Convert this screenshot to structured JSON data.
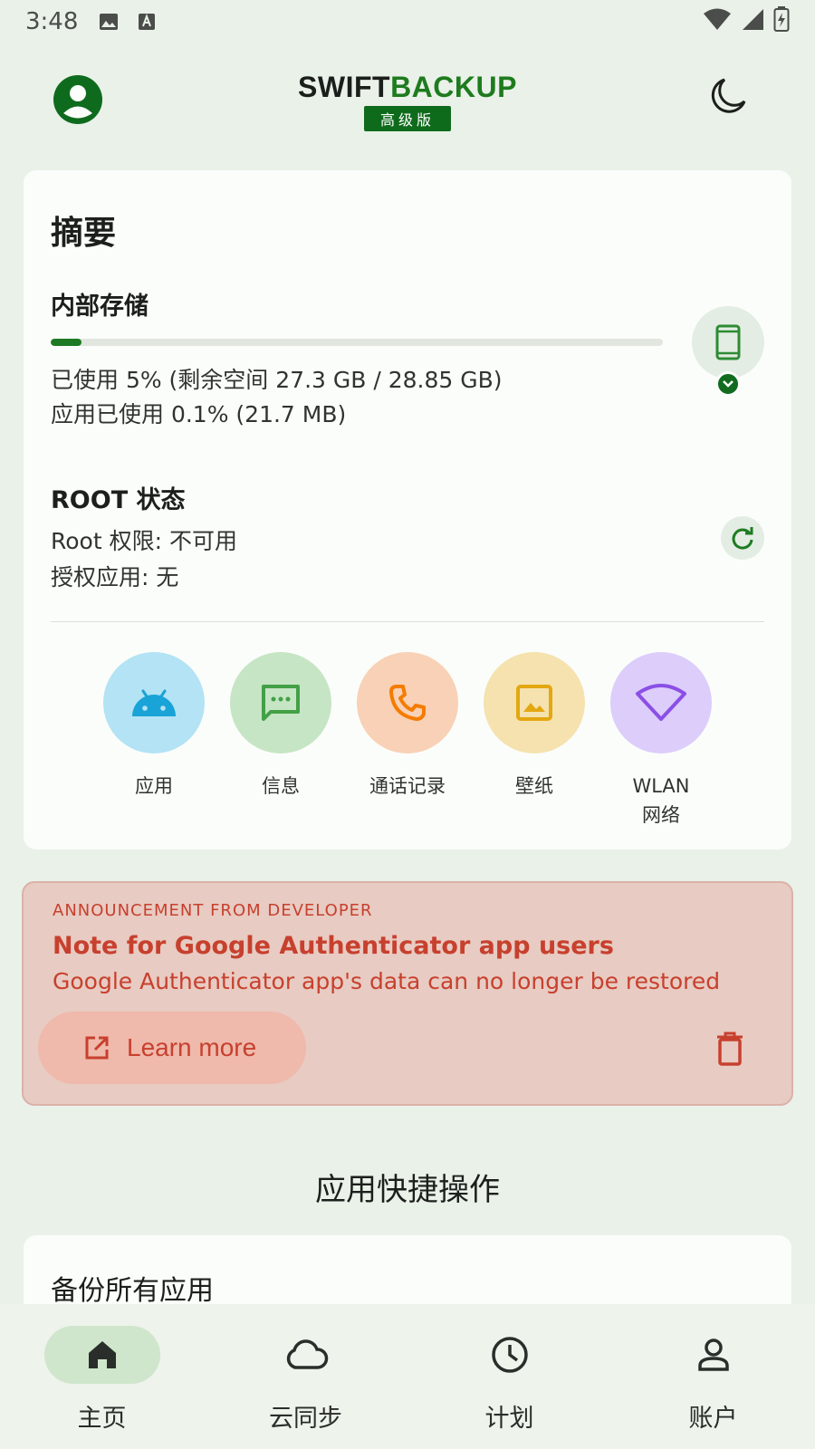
{
  "status_bar": {
    "time": "3:48"
  },
  "header": {
    "logo_part1": "SWIFT",
    "logo_part2": "BACKUP",
    "badge": "高级版"
  },
  "summary": {
    "title": "摘要",
    "storage": {
      "title": "内部存储",
      "used_percent": 5,
      "line1": "已使用 5% (剩余空间 27.3 GB / 28.85 GB)",
      "line2": "应用已使用 0.1% (21.7 MB)"
    },
    "root": {
      "title": "ROOT 状态",
      "line1": "Root 权限: 不可用",
      "line2": "授权应用: 无"
    },
    "categories": [
      {
        "label": "应用",
        "icon": "android-icon",
        "bg": "#b3e3f4",
        "color": "#1aa3d6"
      },
      {
        "label": "信息",
        "icon": "message-icon",
        "bg": "#c6e5c4",
        "color": "#43a047"
      },
      {
        "label": "通话记录",
        "icon": "phone-icon",
        "bg": "#f8d1b6",
        "color": "#f57c00"
      },
      {
        "label": "壁纸",
        "icon": "image-icon",
        "bg": "#f5e2ae",
        "color": "#e3a711"
      },
      {
        "label": "WLAN\n网络",
        "icon": "wifi-icon",
        "bg": "#dccdfb",
        "color": "#8b4fe6"
      }
    ]
  },
  "announcement": {
    "eyebrow": "ANNOUNCEMENT FROM DEVELOPER",
    "title": "Note for Google Authenticator app users",
    "body": "Google Authenticator app's data can no longer be restored",
    "learn_more": "Learn more",
    "accent": "#c7402e"
  },
  "quick_actions": {
    "title": "应用快捷操作",
    "first_item": "备份所有应用"
  },
  "bottom_nav": {
    "items": [
      {
        "label": "主页",
        "icon": "home-icon",
        "active": true
      },
      {
        "label": "云同步",
        "icon": "cloud-icon",
        "active": false
      },
      {
        "label": "计划",
        "icon": "clock-icon",
        "active": false
      },
      {
        "label": "账户",
        "icon": "account-icon",
        "active": false
      }
    ]
  },
  "colors": {
    "brand_green": "#1e7b1e",
    "background": "#eaf1e9"
  }
}
